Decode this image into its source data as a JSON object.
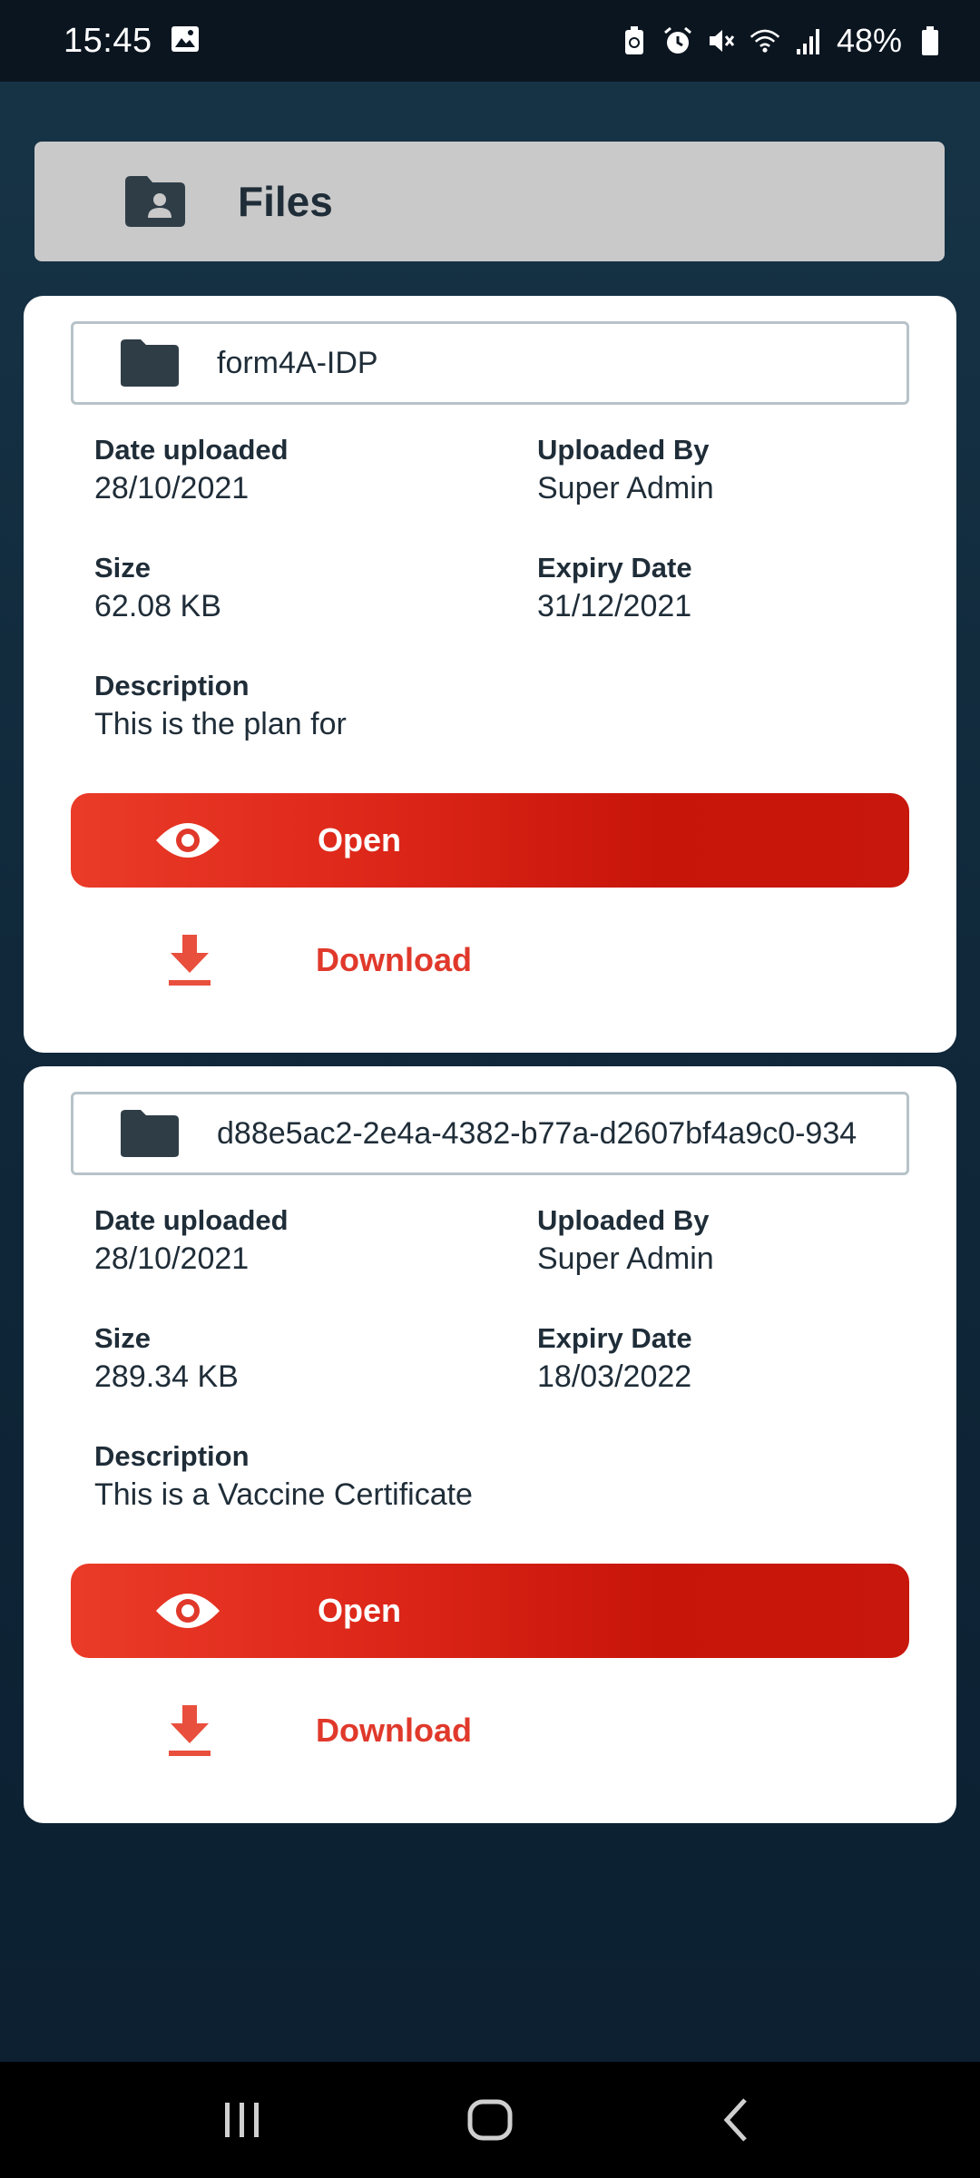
{
  "status_bar": {
    "time": "15:45",
    "battery": "48%",
    "icons": [
      "image-icon",
      "battery-saver-icon",
      "alarm-icon",
      "mute-icon",
      "wifi-icon",
      "signal-icon",
      "battery-icon"
    ]
  },
  "header": {
    "title": "Files",
    "icon": "folder-user-icon"
  },
  "files": [
    {
      "name": "form4A-IDP",
      "date_uploaded_label": "Date uploaded",
      "date_uploaded": "28/10/2021",
      "uploaded_by_label": "Uploaded By",
      "uploaded_by": "Super Admin",
      "size_label": "Size",
      "size": "62.08 KB",
      "expiry_label": "Expiry Date",
      "expiry": "31/12/2021",
      "description_label": "Description",
      "description": "This is the plan for",
      "open_label": "Open",
      "download_label": "Download"
    },
    {
      "name": "d88e5ac2-2e4a-4382-b77a-d2607bf4a9c0-934",
      "date_uploaded_label": "Date uploaded",
      "date_uploaded": "28/10/2021",
      "uploaded_by_label": "Uploaded By",
      "uploaded_by": "Super Admin",
      "size_label": "Size",
      "size": "289.34 KB",
      "expiry_label": "Expiry Date",
      "expiry": "18/03/2022",
      "description_label": "Description",
      "description": "This is a Vaccine Certificate",
      "open_label": "Open",
      "download_label": "Download"
    }
  ],
  "colors": {
    "accent_red": "#e0392b",
    "header_bg": "#c9c9c9",
    "background": "#10283a",
    "icon_dark": "#2f3d47"
  },
  "nav_bar": {
    "buttons": [
      "recent-apps-icon",
      "home-icon",
      "back-icon"
    ]
  }
}
